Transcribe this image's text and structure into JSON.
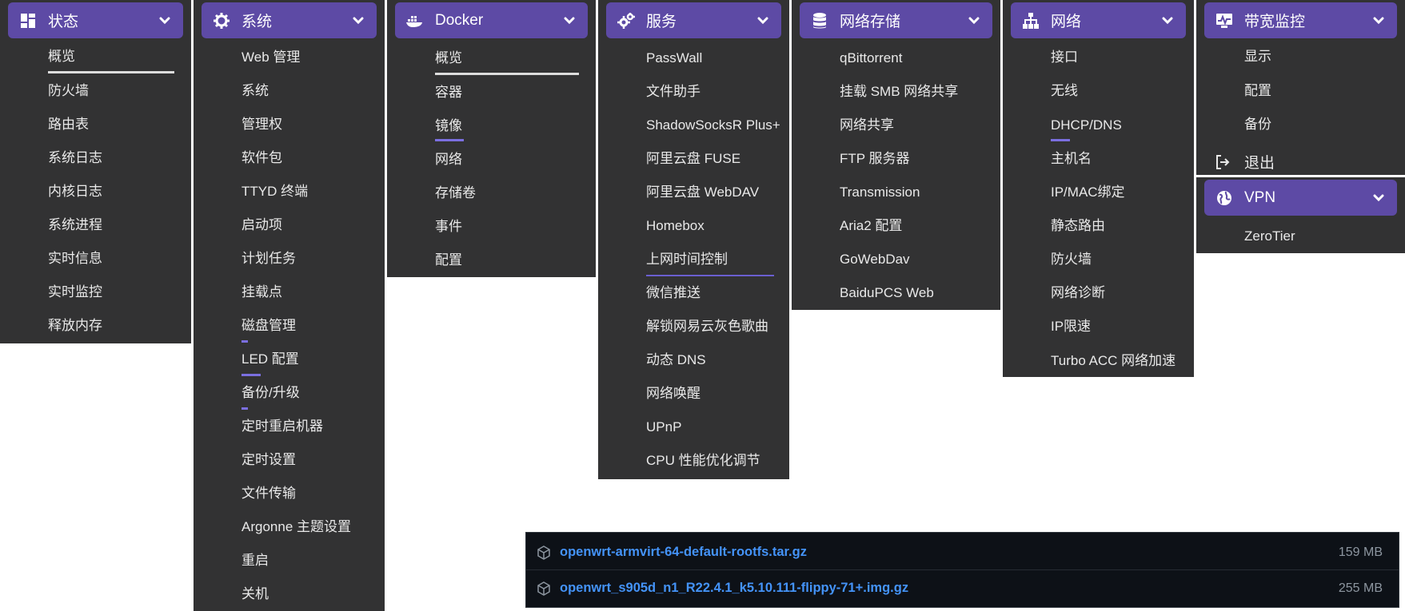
{
  "menus": {
    "status": {
      "title": "状态",
      "items": [
        "概览",
        "防火墙",
        "路由表",
        "系统日志",
        "内核日志",
        "系统进程",
        "实时信息",
        "实时监控",
        "释放内存"
      ]
    },
    "system": {
      "title": "系统",
      "items": [
        "Web 管理",
        "系统",
        "管理权",
        "软件包",
        "TTYD 终端",
        "启动项",
        "计划任务",
        "挂载点",
        "磁盘管理",
        "LED 配置",
        "备份/升级",
        "定时重启机器",
        "定时设置",
        "文件传输",
        "Argonne 主题设置",
        "重启",
        "关机"
      ]
    },
    "docker": {
      "title": "Docker",
      "items": [
        "概览",
        "容器",
        "镜像",
        "网络",
        "存储卷",
        "事件",
        "配置"
      ]
    },
    "services": {
      "title": "服务",
      "items": [
        "PassWall",
        "文件助手",
        "ShadowSocksR Plus+",
        "阿里云盘 FUSE",
        "阿里云盘 WebDAV",
        "Homebox",
        "上网时间控制",
        "微信推送",
        "解锁网易云灰色歌曲",
        "动态 DNS",
        "网络唤醒",
        "UPnP",
        "CPU 性能优化调节"
      ]
    },
    "nas": {
      "title": "网络存储",
      "items": [
        "qBittorrent",
        "挂载 SMB 网络共享",
        "网络共享",
        "FTP 服务器",
        "Transmission",
        "Aria2 配置",
        "GoWebDav",
        "BaiduPCS Web"
      ]
    },
    "network": {
      "title": "网络",
      "items": [
        "接口",
        "无线",
        "DHCP/DNS",
        "主机名",
        "IP/MAC绑定",
        "静态路由",
        "防火墙",
        "网络诊断",
        "IP限速",
        "Turbo ACC 网络加速"
      ]
    },
    "bandwidth": {
      "title": "带宽监控",
      "items": [
        "显示",
        "配置",
        "备份"
      ],
      "logout": "退出"
    },
    "vpn": {
      "title": "VPN",
      "items": [
        "ZeroTier"
      ]
    }
  },
  "downloads": [
    {
      "name": "openwrt-armvirt-64-default-rootfs.tar.gz",
      "size": "159 MB"
    },
    {
      "name": "openwrt_s905d_n1_R22.4.1_k5.10.111-flippy-71+.img.gz",
      "size": "255 MB"
    }
  ],
  "colors": {
    "menu_bg": "#323233",
    "header_bg": "#5d4aa5",
    "link_blue": "#4493f8",
    "accent_underline": "#6a5fd0"
  }
}
